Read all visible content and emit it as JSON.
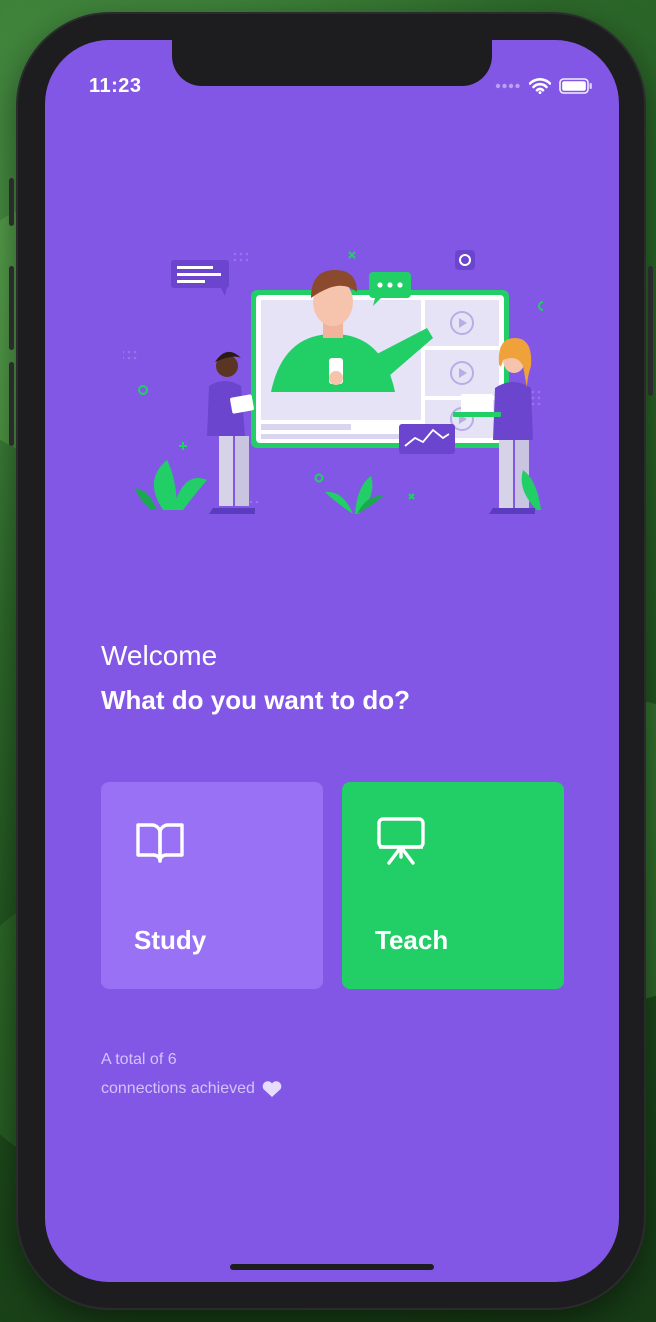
{
  "status_bar": {
    "time": "11:23",
    "icons": [
      "signal-icon",
      "wifi-icon",
      "battery-icon"
    ]
  },
  "header": {
    "welcome": "Welcome",
    "question": "What do you want to do?"
  },
  "actions": [
    {
      "label": "Study",
      "icon": "book-open-icon",
      "color": "#9871f5"
    },
    {
      "label": "Teach",
      "icon": "presentation-board-icon",
      "color": "#21cf66"
    }
  ],
  "footer": {
    "connections_line1": "A total of 6",
    "connections_line2": "connections achieved",
    "icon": "heart-icon"
  },
  "colors": {
    "background": "#8257e5",
    "study_card": "#9871f5",
    "teach_card": "#21cf66",
    "muted_text": "#d4c2ff"
  }
}
